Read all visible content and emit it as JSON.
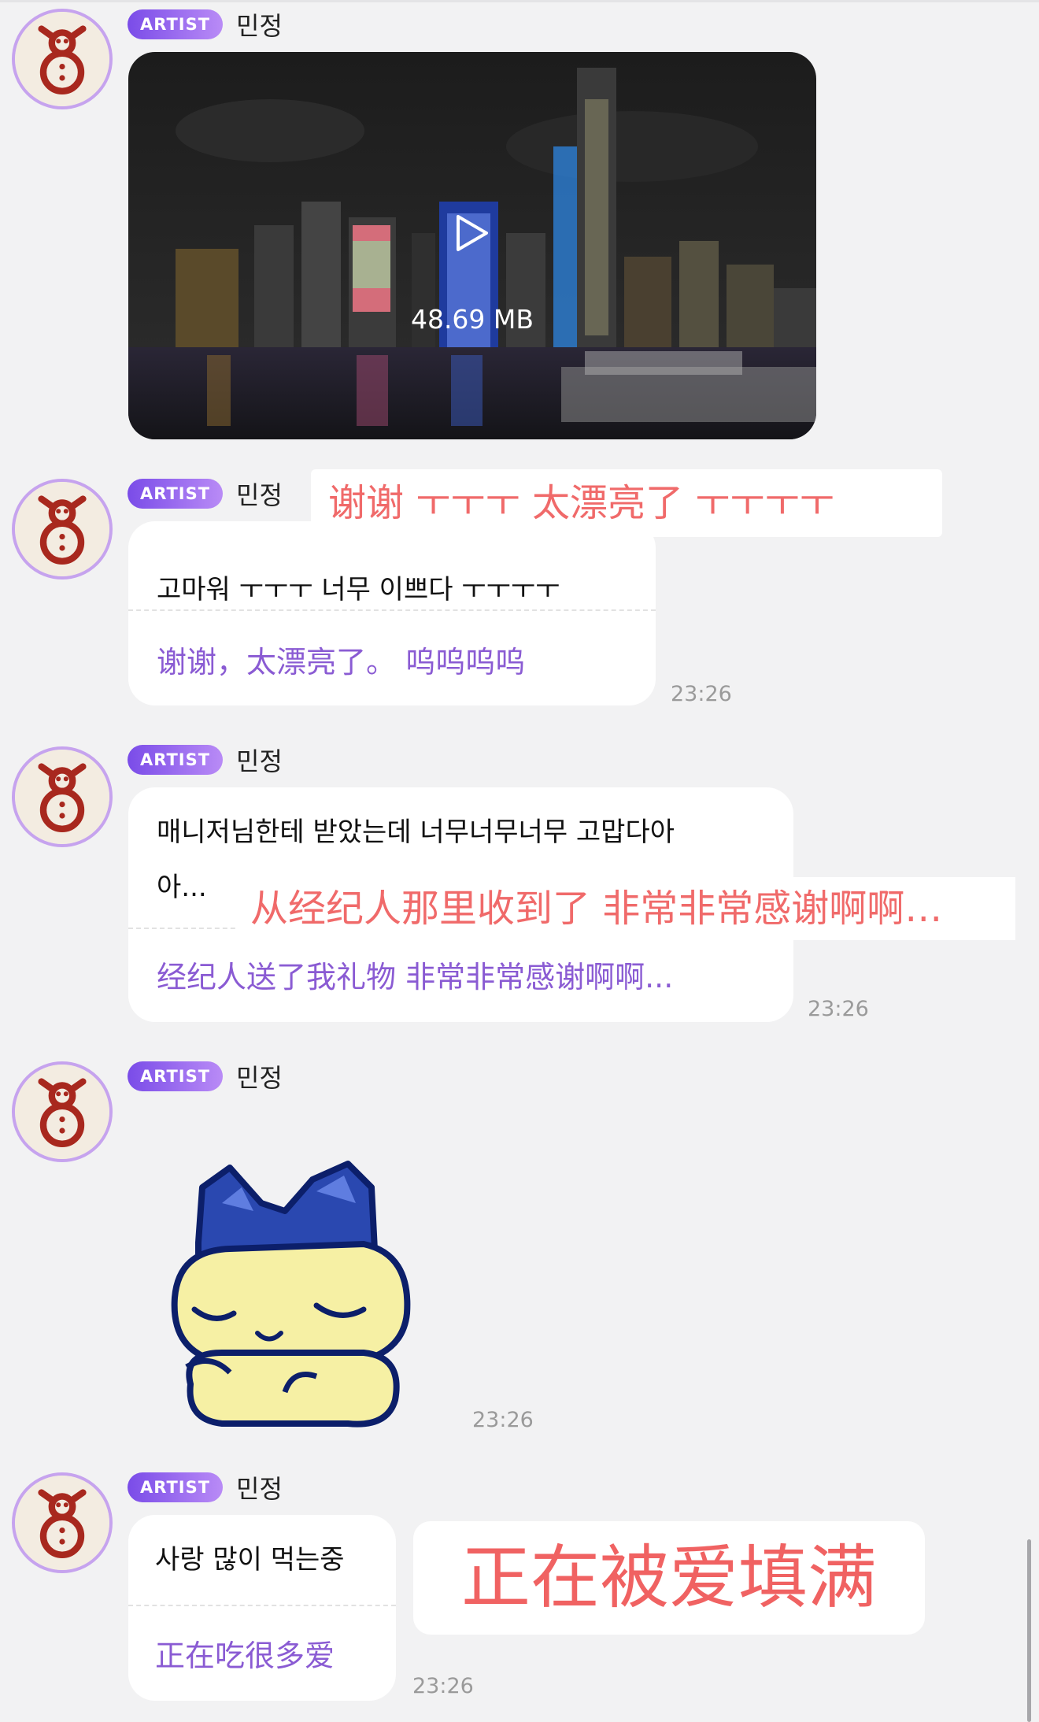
{
  "colors": {
    "background": "#f2f2f3",
    "translation": "#8a5bd3",
    "overlay_text": "#f06a6a",
    "badge_gradient_start": "#7a4ce8",
    "badge_gradient_end": "#b98bf6"
  },
  "messages": [
    {
      "badge": "ARTIST",
      "sender": "민정",
      "type": "video",
      "file_size": "48.69 MB",
      "icon": "play-icon"
    },
    {
      "badge": "ARTIST",
      "sender": "민정",
      "original": "고마워 ㅜㅜㅜ 너무 이쁘다 ㅜㅜㅜㅜ",
      "translation": "谢谢，太漂亮了。 呜呜呜呜",
      "time": "23:26",
      "overlay": "谢谢 ㅜㅜㅜ 太漂亮了 ㅜㅜㅜㅜ"
    },
    {
      "badge": "ARTIST",
      "sender": "민정",
      "original_line1": "매니저님한테 받았는데 너무너무너무 고맙다아",
      "original_line2": "아...",
      "translation": "经纪人送了我礼物 非常非常感谢啊啊...",
      "time": "23:26",
      "overlay": "从经纪人那里收到了 非常非常感谢啊啊…"
    },
    {
      "badge": "ARTIST",
      "sender": "민정",
      "type": "sticker",
      "sticker": "sleepy-bunny-sticker",
      "time": "23:26"
    },
    {
      "badge": "ARTIST",
      "sender": "민정",
      "original": "사랑 많이 먹는중",
      "translation": "正在吃很多爱",
      "time": "23:26",
      "overlay": "正在被爱填满"
    }
  ]
}
